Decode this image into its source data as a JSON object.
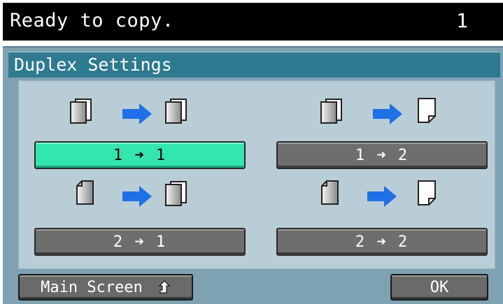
{
  "status": {
    "message": "Ready to copy.",
    "copies": "1"
  },
  "dialog": {
    "title": "Duplex Settings"
  },
  "options": [
    {
      "label": "1 ➜ 1",
      "selected": true,
      "from": "1-sided",
      "to": "1-sided"
    },
    {
      "label": "1 ➜ 2",
      "selected": false,
      "from": "1-sided",
      "to": "2-sided"
    },
    {
      "label": "2 ➜ 1",
      "selected": false,
      "from": "2-sided",
      "to": "1-sided"
    },
    {
      "label": "2 ➜ 2",
      "selected": false,
      "from": "2-sided",
      "to": "2-sided"
    }
  ],
  "footer": {
    "main_screen_label": "Main Screen",
    "ok_label": "OK"
  },
  "icons": {
    "stack": "stacked-pages-icon",
    "single": "single-page-icon",
    "folded": "folded-page-icon",
    "arrow": "blue-arrow-right-icon",
    "main_screen": "up-arrow-icon"
  },
  "colors": {
    "status_bg": "#000000",
    "panel_bg": "#7fa2b2",
    "header_bg": "#2e7a90",
    "inner_bg": "#b8cdd6",
    "selected": "#33e6ad",
    "button": "#6e6e6e",
    "arrow": "#1f6fe6"
  }
}
